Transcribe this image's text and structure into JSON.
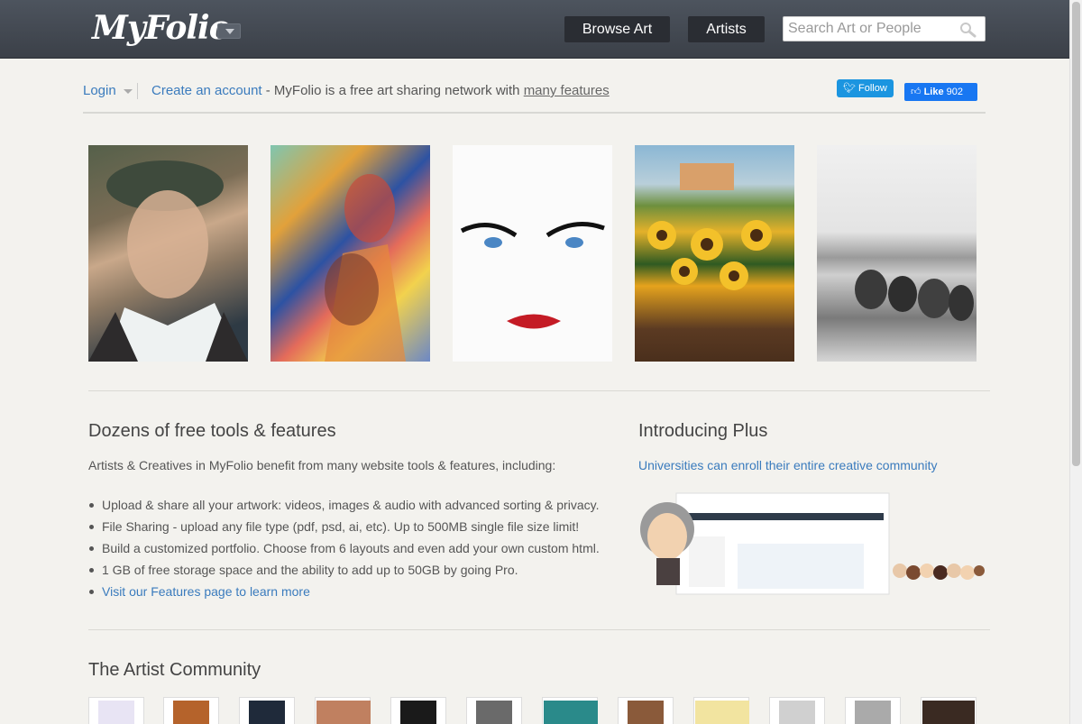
{
  "header": {
    "logo": "MyFolio",
    "nav": {
      "browse": "Browse Art",
      "artists": "Artists"
    },
    "search_placeholder": "Search Art or People"
  },
  "login_row": {
    "login": "Login",
    "create_account": "Create an account",
    "tagline_mid": " - MyFolio is a free art sharing network with ",
    "features_link": "many features",
    "twitter_label": "Follow",
    "fb_label": "Like",
    "fb_count": "902"
  },
  "tools": {
    "heading": "Dozens of free tools & features",
    "intro": "Artists & Creatives in MyFolio benefit from many website tools & features, including:",
    "items": [
      "Upload & share all your artwork: videos, images & audio with advanced sorting & privacy.",
      "File Sharing - upload any file type (pdf, psd, ai, etc). Up to 500MB single file size limit!",
      "Build a customized portfolio. Choose from 6 layouts and even add your own custom html.",
      "1 GB of free storage space and the ability to add up to 50GB by going Pro.",
      "Visit our Features page to learn more"
    ]
  },
  "plus": {
    "heading": "Introducing Plus",
    "link": "Universities can enroll their entire creative community"
  },
  "community": {
    "heading": "The Artist Community"
  },
  "colors": {
    "accent": "#3a7bbd",
    "topbar": "#434952"
  }
}
